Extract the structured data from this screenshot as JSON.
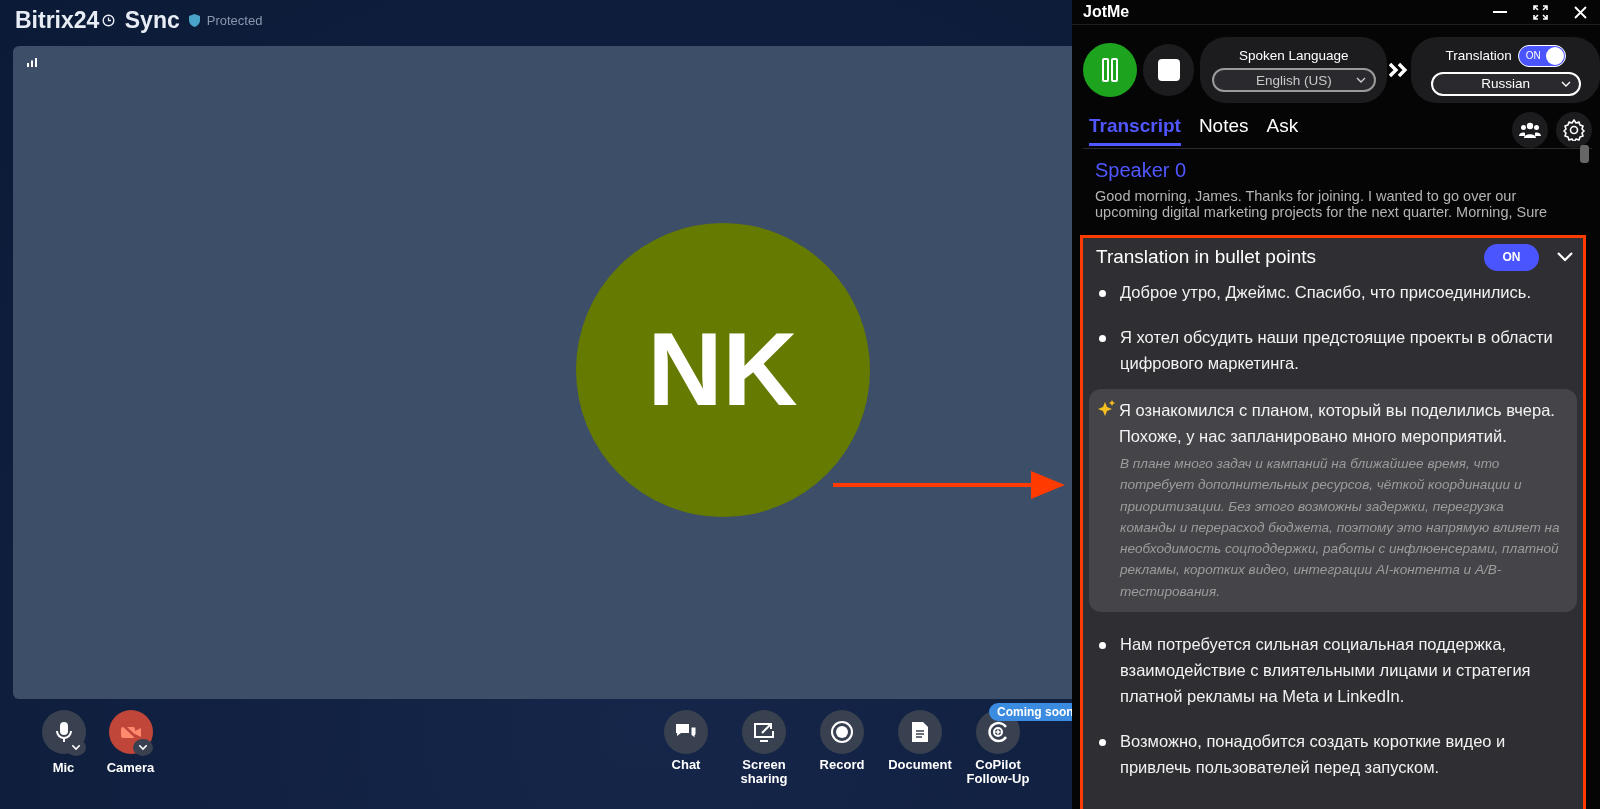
{
  "app": {
    "title": "Bitrix24",
    "suffix": "Sync",
    "badge": "Protected"
  },
  "video": {
    "initials": "NK"
  },
  "toolbar": {
    "devices": [
      {
        "kind": "mic",
        "label": "Mic",
        "muted": false
      },
      {
        "kind": "camera",
        "label": "Camera",
        "muted": true
      }
    ],
    "actions": [
      {
        "kind": "chat",
        "label": "Chat"
      },
      {
        "kind": "screen",
        "label": "Screen sharing"
      },
      {
        "kind": "record",
        "label": "Record"
      },
      {
        "kind": "document",
        "label": "Document"
      },
      {
        "kind": "copilot",
        "label": "CoPilot Follow-Up",
        "badge": "Coming soon"
      }
    ]
  },
  "jotme": {
    "title": "JotMe",
    "recording": {
      "paused": false
    },
    "spoken": {
      "label": "Spoken Language",
      "value": "English (US)"
    },
    "translation": {
      "label": "Translation",
      "toggle": "ON",
      "on": true,
      "value": "Russian"
    },
    "tabs": [
      {
        "label": "Transcript",
        "selected": true
      },
      {
        "label": "Notes",
        "selected": false
      },
      {
        "label": "Ask",
        "selected": false
      }
    ],
    "transcript": {
      "speaker": "Speaker 0",
      "text": "Good morning, James. Thanks for joining. I wanted to go over our upcoming digital marketing projects for the next quarter. Morning, Sure"
    },
    "bullets": {
      "title": "Translation in bullet points",
      "toggle": "ON",
      "on": true,
      "expanded": true,
      "items": [
        {
          "kind": "bullet",
          "text": "Доброе утро, Джеймс. Спасибо, что присоединились."
        },
        {
          "kind": "bullet",
          "text": "Я хотел обсудить наши предстоящие проекты в области цифрового маркетинга."
        },
        {
          "kind": "insight",
          "text": "Я ознакомился с планом, который вы поделились вчера. Похоже, у нас запланировано много мероприятий.",
          "detail": "В плане много задач и кампаний на ближайшее время, что потребует дополнительных ресурсов, чёткой координации и приоритизации. Без этого возможны задержки, перегрузка команды и перерасход бюджета, поэтому это напрямую влияет на необходимость соцподдержки, работы с инфлюенсерами, платной рекламы, коротких видео, интеграции AI-контента и A/B-тестирования."
        },
        {
          "kind": "bullet",
          "text": "Нам потребуется сильная социальная поддержка, взаимодействие с влиятельными лицами и стратегия платной рекламы на Meta и LinkedIn."
        },
        {
          "kind": "bullet",
          "text": "Возможно, понадобится создать короткие видео и привлечь пользователей перед запуском."
        }
      ]
    }
  }
}
